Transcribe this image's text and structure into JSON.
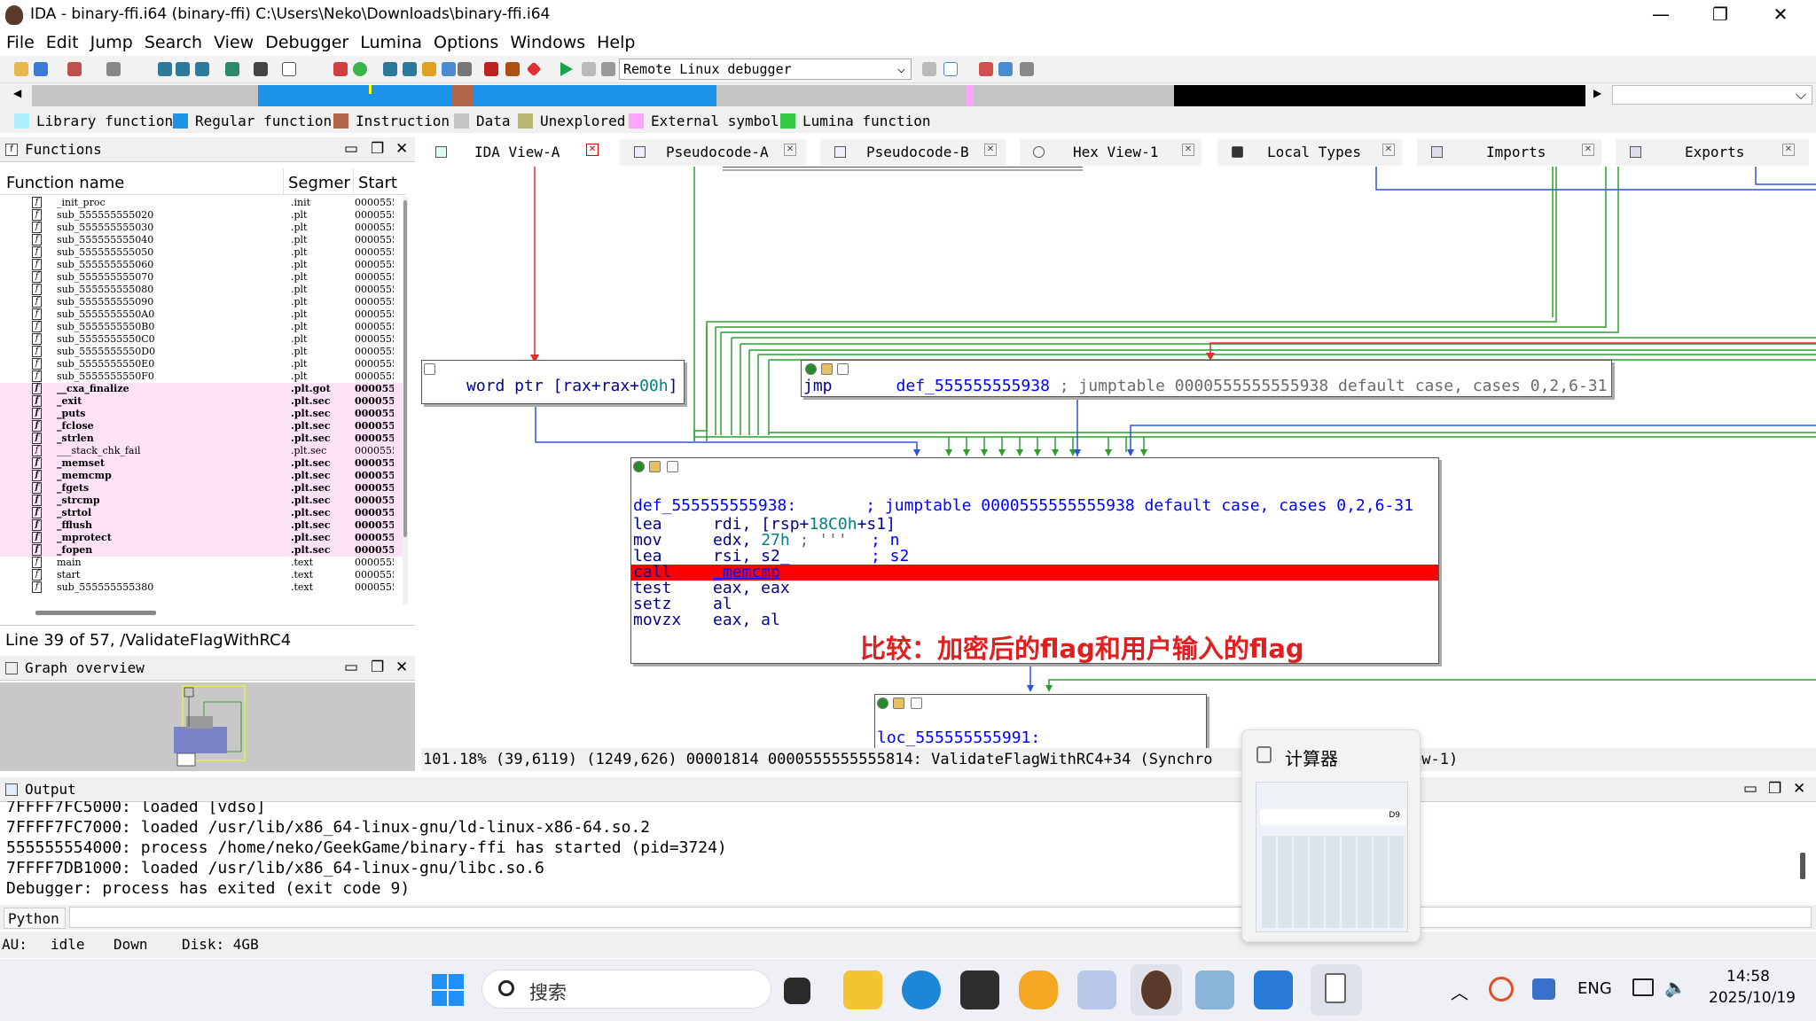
{
  "window": {
    "title": "IDA - binary-ffi.i64 (binary-ffi) C:\\Users\\Neko\\Downloads\\binary-ffi.i64"
  },
  "menu": [
    "File",
    "Edit",
    "Jump",
    "Search",
    "View",
    "Debugger",
    "Lumina",
    "Options",
    "Windows",
    "Help"
  ],
  "toolbar": {
    "debugger": "Remote Linux debugger"
  },
  "legend": [
    {
      "label": "Library function",
      "color": "#aeeefe"
    },
    {
      "label": "Regular function",
      "color": "#1a93e8"
    },
    {
      "label": "Instruction",
      "color": "#b3654a"
    },
    {
      "label": "Data",
      "color": "#c4c4c4"
    },
    {
      "label": "Unexplored",
      "color": "#bbb674"
    },
    {
      "label": "External symbol",
      "color": "#fda5fb"
    },
    {
      "label": "Lumina function",
      "color": "#33cc44"
    }
  ],
  "functions_panel": {
    "title": "Functions",
    "col_name": "Function name",
    "col_seg": "Segmer",
    "col_start": "Start",
    "rows": [
      {
        "name": "_init_proc",
        "seg": ".init",
        "start": "0000555",
        "pink": false,
        "bold": false
      },
      {
        "name": "sub_555555555020",
        "seg": ".plt",
        "start": "0000555",
        "pink": false,
        "bold": false
      },
      {
        "name": "sub_555555555030",
        "seg": ".plt",
        "start": "0000555",
        "pink": false,
        "bold": false
      },
      {
        "name": "sub_555555555040",
        "seg": ".plt",
        "start": "0000555",
        "pink": false,
        "bold": false
      },
      {
        "name": "sub_555555555050",
        "seg": ".plt",
        "start": "0000555",
        "pink": false,
        "bold": false
      },
      {
        "name": "sub_555555555060",
        "seg": ".plt",
        "start": "0000555",
        "pink": false,
        "bold": false
      },
      {
        "name": "sub_555555555070",
        "seg": ".plt",
        "start": "0000555",
        "pink": false,
        "bold": false
      },
      {
        "name": "sub_555555555080",
        "seg": ".plt",
        "start": "0000555",
        "pink": false,
        "bold": false
      },
      {
        "name": "sub_555555555090",
        "seg": ".plt",
        "start": "0000555",
        "pink": false,
        "bold": false
      },
      {
        "name": "sub_5555555550A0",
        "seg": ".plt",
        "start": "0000555",
        "pink": false,
        "bold": false
      },
      {
        "name": "sub_5555555550B0",
        "seg": ".plt",
        "start": "0000555",
        "pink": false,
        "bold": false
      },
      {
        "name": "sub_5555555550C0",
        "seg": ".plt",
        "start": "0000555",
        "pink": false,
        "bold": false
      },
      {
        "name": "sub_5555555550D0",
        "seg": ".plt",
        "start": "0000555",
        "pink": false,
        "bold": false
      },
      {
        "name": "sub_5555555550E0",
        "seg": ".plt",
        "start": "0000555",
        "pink": false,
        "bold": false
      },
      {
        "name": "sub_5555555550F0",
        "seg": ".plt",
        "start": "0000555",
        "pink": false,
        "bold": false
      },
      {
        "name": "__cxa_finalize",
        "seg": ".plt.got",
        "start": "000055",
        "pink": true,
        "bold": true
      },
      {
        "name": "_exit",
        "seg": ".plt.sec",
        "start": "000055",
        "pink": true,
        "bold": true
      },
      {
        "name": "_puts",
        "seg": ".plt.sec",
        "start": "000055",
        "pink": true,
        "bold": true
      },
      {
        "name": "_fclose",
        "seg": ".plt.sec",
        "start": "000055",
        "pink": true,
        "bold": true
      },
      {
        "name": "_strlen",
        "seg": ".plt.sec",
        "start": "000055",
        "pink": true,
        "bold": true
      },
      {
        "name": "___stack_chk_fail",
        "seg": ".plt.sec",
        "start": "0000555",
        "pink": true,
        "bold": false
      },
      {
        "name": "_memset",
        "seg": ".plt.sec",
        "start": "000055",
        "pink": true,
        "bold": true
      },
      {
        "name": "_memcmp",
        "seg": ".plt.sec",
        "start": "000055",
        "pink": true,
        "bold": true
      },
      {
        "name": "_fgets",
        "seg": ".plt.sec",
        "start": "000055",
        "pink": true,
        "bold": true
      },
      {
        "name": "_strcmp",
        "seg": ".plt.sec",
        "start": "000055",
        "pink": true,
        "bold": true
      },
      {
        "name": "_strtol",
        "seg": ".plt.sec",
        "start": "000055",
        "pink": true,
        "bold": true
      },
      {
        "name": "_fflush",
        "seg": ".plt.sec",
        "start": "000055",
        "pink": true,
        "bold": true
      },
      {
        "name": "_mprotect",
        "seg": ".plt.sec",
        "start": "000055",
        "pink": true,
        "bold": true
      },
      {
        "name": "_fopen",
        "seg": ".plt.sec",
        "start": "000055",
        "pink": true,
        "bold": true
      },
      {
        "name": "main",
        "seg": ".text",
        "start": "0000555",
        "pink": false,
        "bold": false
      },
      {
        "name": "start",
        "seg": ".text",
        "start": "0000555",
        "pink": false,
        "bold": false
      },
      {
        "name": "sub_555555555380",
        "seg": ".text",
        "start": "0000555",
        "pink": false,
        "bold": false
      }
    ],
    "status": "Line 39 of 57, /ValidateFlagWithRC4"
  },
  "graph_overview": {
    "title": "Graph overview"
  },
  "tabs": [
    "IDA View-A",
    "Pseudocode-A",
    "Pseudocode-B",
    "Hex View-1",
    "Local Types",
    "Imports",
    "Exports"
  ],
  "graph": {
    "node_left": {
      "text": "word ptr [rax+rax+",
      "imm": "00h",
      "close": "]"
    },
    "node_jmp": {
      "mnem": "jmp",
      "target": "def_555555555938",
      "comment": "; jumptable 0000555555555938 default case, cases 0,2,6-31"
    },
    "node_main": {
      "label": "def_555555555938:",
      "comment": "; jumptable 0000555555555938 default case, cases 0,2,6-31",
      "lines": [
        {
          "m": "lea",
          "a": "rdi, [rsp+",
          "imm": "18C0h",
          "b": "+s1]",
          "c": ""
        },
        {
          "m": "mov",
          "a": "edx, ",
          "imm": "27h",
          "b": " ; '''",
          "c": "; n"
        },
        {
          "m": "lea",
          "a": "rsi, s2_",
          "imm": "",
          "b": "",
          "c": "; s2"
        },
        {
          "m": "call",
          "a": "_memcmp",
          "imm": "",
          "b": "",
          "c": ""
        },
        {
          "m": "test",
          "a": "eax, eax",
          "imm": "",
          "b": "",
          "c": ""
        },
        {
          "m": "setz",
          "a": "al",
          "imm": "",
          "b": "",
          "c": ""
        },
        {
          "m": "movzx",
          "a": "eax, al",
          "imm": "",
          "b": "",
          "c": ""
        }
      ],
      "annotation": "比较：加密后的flag和用户输入的flag"
    },
    "node_loc": {
      "label": "loc_555555555991:"
    }
  },
  "graph_status": "101.18% (39,6119) (1249,626) 00001814 0000555555555814: ValidateFlagWithRC4+34 (Synchro",
  "graph_status_tail": "ew-1)",
  "calculator_popup": {
    "title": "计算器",
    "display": "D9"
  },
  "output": {
    "title": "Output",
    "lines": [
      "7FFFF7FC5000: loaded [vdso]",
      "7FFFF7FC7000: loaded /usr/lib/x86_64-linux-gnu/ld-linux-x86-64.so.2",
      "555555554000: process /home/neko/GeekGame/binary-ffi has started (pid=3724)",
      "7FFFF7DB1000: loaded /usr/lib/x86_64-linux-gnu/libc.so.6",
      "Debugger: process has exited (exit code 9)"
    ],
    "lang": "Python"
  },
  "statusbar": {
    "au": "AU:",
    "state": "idle",
    "dir": "Down",
    "disk": "Disk: 4GB"
  },
  "taskbar": {
    "search": "搜索",
    "lang": "ENG",
    "time": "14:58",
    "date": "2025/10/19"
  }
}
